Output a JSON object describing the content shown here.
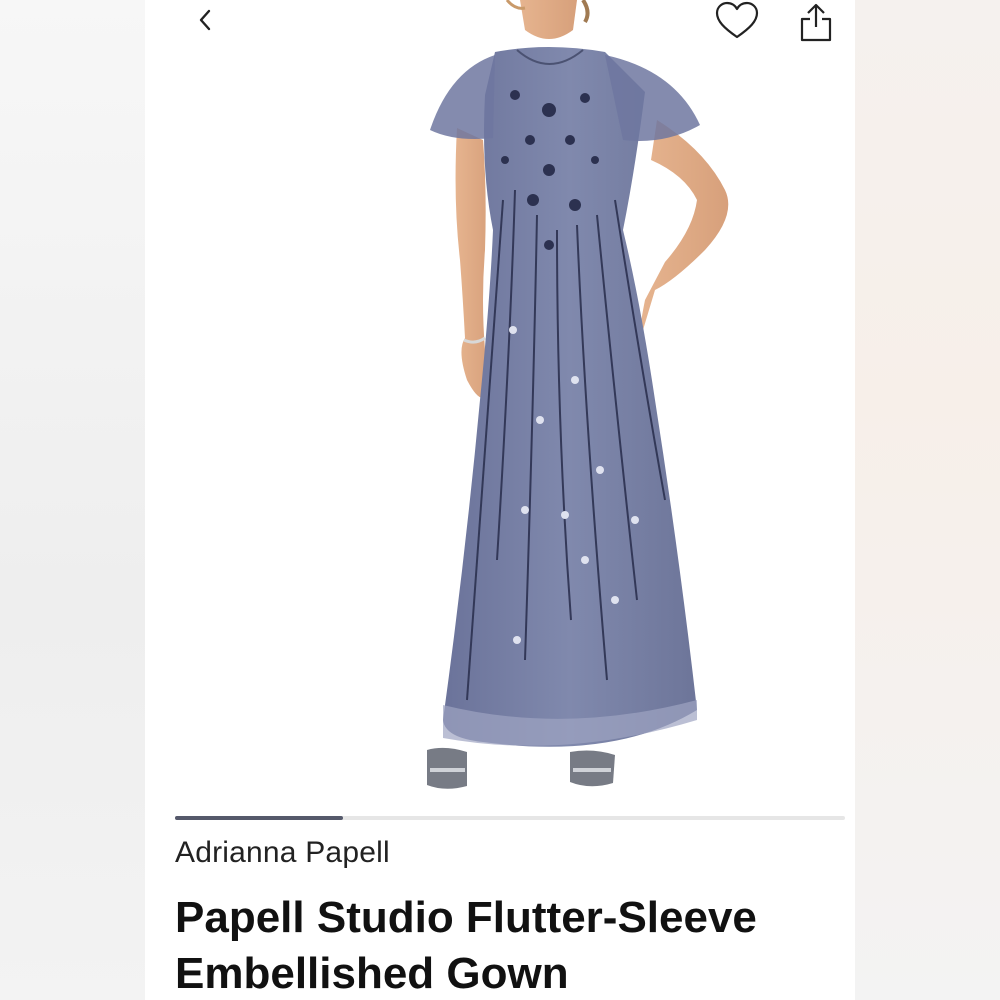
{
  "product": {
    "brand": "Adrianna Papell",
    "title": "Papell Studio Flutter-Sleeve Embellished Gown",
    "image_alt": "Model wearing a blue-gray beaded flutter-sleeve maxi gown"
  },
  "gallery": {
    "progress": 0.25
  },
  "icons": {
    "back": "chevron-left-icon",
    "favorite": "heart-outline-icon",
    "share": "share-icon"
  },
  "colors": {
    "gown": "#7b84aa",
    "beading": "#2c3150",
    "progress": "#55596b"
  }
}
